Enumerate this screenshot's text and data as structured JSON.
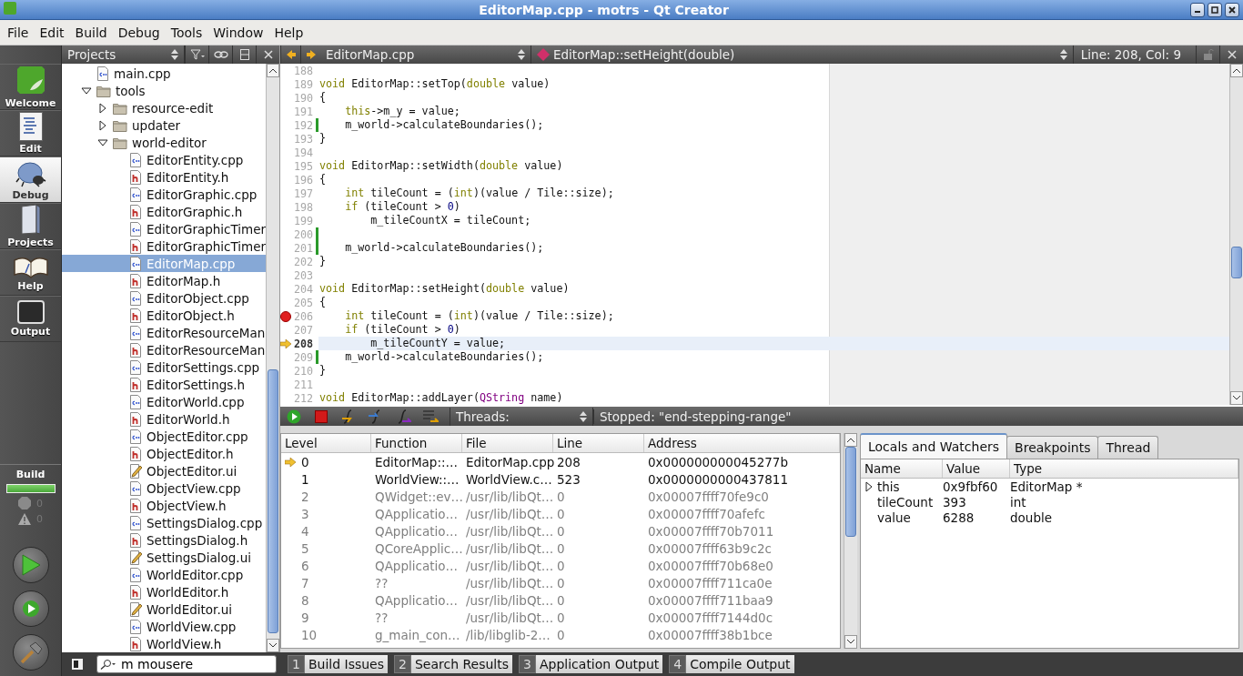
{
  "window": {
    "title": "EditorMap.cpp - motrs - Qt Creator"
  },
  "menu": [
    "File",
    "Edit",
    "Build",
    "Debug",
    "Tools",
    "Window",
    "Help"
  ],
  "modes": [
    {
      "kind": "welcome",
      "label": "Welcome",
      "selected": false
    },
    {
      "kind": "edit",
      "label": "Edit",
      "selected": false
    },
    {
      "kind": "debug",
      "label": "Debug",
      "selected": true
    },
    {
      "kind": "projects",
      "label": "Projects",
      "selected": false
    },
    {
      "kind": "help",
      "label": "Help",
      "selected": false
    },
    {
      "kind": "output",
      "label": "Output",
      "selected": false
    }
  ],
  "build_status": {
    "label": "Build",
    "level": 1,
    "errors": "0",
    "warnings": "0"
  },
  "action_buttons": [
    {
      "kind": "run"
    },
    {
      "kind": "debug"
    },
    {
      "kind": "build"
    }
  ],
  "projects": {
    "title": "Projects",
    "tree": [
      {
        "kind": "cpp",
        "label": "main.cpp",
        "selected": false
      },
      {
        "kind": "folder",
        "label": "tools",
        "expanded": true,
        "selected": false,
        "children": [
          {
            "kind": "folder",
            "label": "resource-edit",
            "expanded": false,
            "selected": false
          },
          {
            "kind": "folder",
            "label": "updater",
            "expanded": false,
            "selected": false
          },
          {
            "kind": "folder",
            "label": "world-editor",
            "expanded": true,
            "selected": false,
            "children": [
              {
                "kind": "cpp",
                "label": "EditorEntity.cpp",
                "selected": false
              },
              {
                "kind": "h",
                "label": "EditorEntity.h",
                "selected": false
              },
              {
                "kind": "cpp",
                "label": "EditorGraphic.cpp",
                "selected": false
              },
              {
                "kind": "h",
                "label": "EditorGraphic.h",
                "selected": false
              },
              {
                "kind": "cpp",
                "label": "EditorGraphicTimer",
                "selected": false
              },
              {
                "kind": "h",
                "label": "EditorGraphicTimer",
                "selected": false
              },
              {
                "kind": "cpp",
                "label": "EditorMap.cpp",
                "selected": true
              },
              {
                "kind": "h",
                "label": "EditorMap.h",
                "selected": false
              },
              {
                "kind": "cpp",
                "label": "EditorObject.cpp",
                "selected": false
              },
              {
                "kind": "h",
                "label": "EditorObject.h",
                "selected": false
              },
              {
                "kind": "cpp",
                "label": "EditorResourceMan",
                "selected": false
              },
              {
                "kind": "h",
                "label": "EditorResourceMan",
                "selected": false
              },
              {
                "kind": "cpp",
                "label": "EditorSettings.cpp",
                "selected": false
              },
              {
                "kind": "h",
                "label": "EditorSettings.h",
                "selected": false
              },
              {
                "kind": "cpp",
                "label": "EditorWorld.cpp",
                "selected": false
              },
              {
                "kind": "h",
                "label": "EditorWorld.h",
                "selected": false
              },
              {
                "kind": "cpp",
                "label": "ObjectEditor.cpp",
                "selected": false
              },
              {
                "kind": "h",
                "label": "ObjectEditor.h",
                "selected": false
              },
              {
                "kind": "ui",
                "label": "ObjectEditor.ui",
                "selected": false
              },
              {
                "kind": "cpp",
                "label": "ObjectView.cpp",
                "selected": false
              },
              {
                "kind": "h",
                "label": "ObjectView.h",
                "selected": false
              },
              {
                "kind": "cpp",
                "label": "SettingsDialog.cpp",
                "selected": false
              },
              {
                "kind": "h",
                "label": "SettingsDialog.h",
                "selected": false
              },
              {
                "kind": "ui",
                "label": "SettingsDialog.ui",
                "selected": false
              },
              {
                "kind": "cpp",
                "label": "WorldEditor.cpp",
                "selected": false
              },
              {
                "kind": "h",
                "label": "WorldEditor.h",
                "selected": false
              },
              {
                "kind": "ui",
                "label": "WorldEditor.ui",
                "selected": false
              },
              {
                "kind": "cpp",
                "label": "WorldView.cpp",
                "selected": false
              },
              {
                "kind": "h",
                "label": "WorldView.h",
                "selected": false
              }
            ]
          }
        ]
      }
    ]
  },
  "editor": {
    "file": "EditorMap.cpp",
    "function": "EditorMap::setHeight(double)",
    "position": "Line: 208, Col: 9",
    "lines": [
      {
        "number": "188",
        "current": false,
        "breakpoint": false,
        "changed": false
      },
      {
        "number": "189",
        "current": false,
        "breakpoint": false,
        "changed": false,
        "spans": [
          {
            "kind": "keyword",
            "text": "void"
          },
          {
            "kind": "plain",
            "text": " EditorMap::setTop("
          },
          {
            "kind": "keyword",
            "text": "double"
          },
          {
            "kind": "plain",
            "text": " value)"
          }
        ]
      },
      {
        "number": "190",
        "current": false,
        "breakpoint": false,
        "changed": false,
        "spans": [
          {
            "kind": "plain",
            "text": "{"
          }
        ]
      },
      {
        "number": "191",
        "current": false,
        "breakpoint": false,
        "changed": false,
        "spans": [
          {
            "kind": "keyword",
            "text": "    this"
          },
          {
            "kind": "plain",
            "text": "->m_y = value;"
          }
        ]
      },
      {
        "number": "192",
        "current": false,
        "breakpoint": false,
        "changed": true,
        "spans": [
          {
            "kind": "plain",
            "text": "    m_world->calculateBoundaries();"
          }
        ]
      },
      {
        "number": "193",
        "current": false,
        "breakpoint": false,
        "changed": false,
        "spans": [
          {
            "kind": "plain",
            "text": "}"
          }
        ]
      },
      {
        "number": "194",
        "current": false,
        "breakpoint": false,
        "changed": false
      },
      {
        "number": "195",
        "current": false,
        "breakpoint": false,
        "changed": false,
        "spans": [
          {
            "kind": "keyword",
            "text": "void"
          },
          {
            "kind": "plain",
            "text": " EditorMap::setWidth("
          },
          {
            "kind": "keyword",
            "text": "double"
          },
          {
            "kind": "plain",
            "text": " value)"
          }
        ]
      },
      {
        "number": "196",
        "current": false,
        "breakpoint": false,
        "changed": false,
        "spans": [
          {
            "kind": "plain",
            "text": "{"
          }
        ]
      },
      {
        "number": "197",
        "current": false,
        "breakpoint": false,
        "changed": false,
        "spans": [
          {
            "kind": "keyword",
            "text": "    int"
          },
          {
            "kind": "plain",
            "text": " tileCount = ("
          },
          {
            "kind": "keyword",
            "text": "int"
          },
          {
            "kind": "plain",
            "text": ")(value / Tile::size);"
          }
        ]
      },
      {
        "number": "198",
        "current": false,
        "breakpoint": false,
        "changed": false,
        "spans": [
          {
            "kind": "keyword",
            "text": "    if"
          },
          {
            "kind": "plain",
            "text": " (tileCount > "
          },
          {
            "kind": "number",
            "text": "0"
          },
          {
            "kind": "plain",
            "text": ")"
          }
        ]
      },
      {
        "number": "199",
        "current": false,
        "breakpoint": false,
        "changed": false,
        "spans": [
          {
            "kind": "plain",
            "text": "        m_tileCountX = tileCount;"
          }
        ]
      },
      {
        "number": "200",
        "current": false,
        "breakpoint": false,
        "changed": true
      },
      {
        "number": "201",
        "current": false,
        "breakpoint": false,
        "changed": true,
        "spans": [
          {
            "kind": "plain",
            "text": "    m_world->calculateBoundaries();"
          }
        ]
      },
      {
        "number": "202",
        "current": false,
        "breakpoint": false,
        "changed": false,
        "spans": [
          {
            "kind": "plain",
            "text": "}"
          }
        ]
      },
      {
        "number": "203",
        "current": false,
        "breakpoint": false,
        "changed": false
      },
      {
        "number": "204",
        "current": false,
        "breakpoint": false,
        "changed": false,
        "spans": [
          {
            "kind": "keyword",
            "text": "void"
          },
          {
            "kind": "plain",
            "text": " EditorMap::setHeight("
          },
          {
            "kind": "keyword",
            "text": "double"
          },
          {
            "kind": "plain",
            "text": " value)"
          }
        ]
      },
      {
        "number": "205",
        "current": false,
        "breakpoint": false,
        "changed": false,
        "spans": [
          {
            "kind": "plain",
            "text": "{"
          }
        ]
      },
      {
        "number": "206",
        "current": false,
        "breakpoint": true,
        "changed": false,
        "spans": [
          {
            "kind": "keyword",
            "text": "    int"
          },
          {
            "kind": "plain",
            "text": " tileCount = ("
          },
          {
            "kind": "keyword",
            "text": "int"
          },
          {
            "kind": "plain",
            "text": ")(value / Tile::size);"
          }
        ]
      },
      {
        "number": "207",
        "current": false,
        "breakpoint": false,
        "changed": false,
        "spans": [
          {
            "kind": "keyword",
            "text": "    if"
          },
          {
            "kind": "plain",
            "text": " (tileCount > "
          },
          {
            "kind": "number",
            "text": "0"
          },
          {
            "kind": "plain",
            "text": ")"
          }
        ]
      },
      {
        "number": "208",
        "current": true,
        "breakpoint": false,
        "changed": false,
        "spans": [
          {
            "kind": "plain",
            "text": "        m_tileCountY = value;"
          }
        ]
      },
      {
        "number": "209",
        "current": false,
        "breakpoint": false,
        "changed": true,
        "spans": [
          {
            "kind": "plain",
            "text": "    m_world->calculateBoundaries();"
          }
        ]
      },
      {
        "number": "210",
        "current": false,
        "breakpoint": false,
        "changed": false,
        "spans": [
          {
            "kind": "plain",
            "text": "}"
          }
        ]
      },
      {
        "number": "211",
        "current": false,
        "breakpoint": false,
        "changed": false
      },
      {
        "number": "212",
        "current": false,
        "breakpoint": false,
        "changed": false,
        "spans": [
          {
            "kind": "keyword",
            "text": "void"
          },
          {
            "kind": "plain",
            "text": " EditorMap::addLayer("
          },
          {
            "kind": "class",
            "text": "QString"
          },
          {
            "kind": "plain",
            "text": " name)"
          }
        ]
      }
    ]
  },
  "debugger": {
    "toolbar": [
      {
        "kind": "continue"
      },
      {
        "kind": "stop"
      },
      {
        "kind": "step-over"
      },
      {
        "kind": "step-into"
      },
      {
        "kind": "step-out"
      },
      {
        "kind": "run-to-line"
      }
    ],
    "threads_label": "Threads:",
    "status": "Stopped: \"end-stepping-range\"",
    "stack": {
      "columns": [
        "Level",
        "Function",
        "File",
        "Line",
        "Address"
      ],
      "rows": [
        {
          "level": "0",
          "function": "EditorMap::…",
          "file": "EditorMap.cpp",
          "line": "208",
          "address": "0x000000000045277b",
          "current": true,
          "has_source": true
        },
        {
          "level": "1",
          "function": "WorldView::…",
          "file": "WorldView.c…",
          "line": "523",
          "address": "0x0000000000437811",
          "current": false,
          "has_source": true
        },
        {
          "level": "2",
          "function": "QWidget::ev…",
          "file": "/usr/lib/libQt…",
          "line": "0",
          "address": "0x00007ffff70fe9c0",
          "current": false,
          "has_source": false
        },
        {
          "level": "3",
          "function": "QApplicatio…",
          "file": "/usr/lib/libQt…",
          "line": "0",
          "address": "0x00007ffff70afefc",
          "current": false,
          "has_source": false
        },
        {
          "level": "4",
          "function": "QApplicatio…",
          "file": "/usr/lib/libQt…",
          "line": "0",
          "address": "0x00007ffff70b7011",
          "current": false,
          "has_source": false
        },
        {
          "level": "5",
          "function": "QCoreApplic…",
          "file": "/usr/lib/libQt…",
          "line": "0",
          "address": "0x00007ffff63b9c2c",
          "current": false,
          "has_source": false
        },
        {
          "level": "6",
          "function": "QApplicatio…",
          "file": "/usr/lib/libQt…",
          "line": "0",
          "address": "0x00007ffff70b68e0",
          "current": false,
          "has_source": false
        },
        {
          "level": "7",
          "function": "??",
          "file": "/usr/lib/libQt…",
          "line": "0",
          "address": "0x00007ffff711ca0e",
          "current": false,
          "has_source": false
        },
        {
          "level": "8",
          "function": "QApplicatio…",
          "file": "/usr/lib/libQt…",
          "line": "0",
          "address": "0x00007ffff711baa9",
          "current": false,
          "has_source": false
        },
        {
          "level": "9",
          "function": "??",
          "file": "/usr/lib/libQt…",
          "line": "0",
          "address": "0x00007ffff7144d0c",
          "current": false,
          "has_source": false
        },
        {
          "level": "10",
          "function": "g_main_con…",
          "file": "/lib/libglib-2…",
          "line": "0",
          "address": "0x00007ffff38b1bce",
          "current": false,
          "has_source": false
        }
      ]
    },
    "tabs": [
      {
        "label": "Locals and Watchers",
        "selected": true
      },
      {
        "label": "Breakpoints",
        "selected": false
      },
      {
        "label": "Thread",
        "selected": false
      }
    ],
    "locals": {
      "columns": [
        "Name",
        "Value",
        "Type"
      ],
      "rows": [
        {
          "name": "this",
          "value": "0x9fbf60",
          "type": "EditorMap *",
          "expandable": true
        },
        {
          "name": "tileCount",
          "value": "393",
          "type": "int",
          "expandable": false
        },
        {
          "name": "value",
          "value": "6288",
          "type": "double",
          "expandable": false
        }
      ]
    }
  },
  "locator": {
    "value": "m mousere"
  },
  "output_tabs": [
    {
      "number": "1",
      "label": "Build Issues"
    },
    {
      "number": "2",
      "label": "Search Results"
    },
    {
      "number": "3",
      "label": "Application Output"
    },
    {
      "number": "4",
      "label": "Compile Output"
    }
  ]
}
